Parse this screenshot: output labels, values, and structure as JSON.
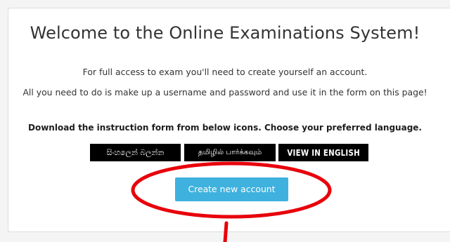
{
  "welcome": {
    "title": "Welcome to the Online Examinations System!",
    "access_text": "For full access to exam you'll need to create yourself an account.",
    "instructions_text": "All you need to do is make up a username and password and use it in the form on this page!",
    "download_text": "Download the instruction form from below icons. Choose your preferred language."
  },
  "languages": {
    "sinhala_label": "සිංහලෙන් බලන්න",
    "tamil_label": "தமிழில் பார்க்கவும்",
    "english_label": "VIEW IN ENGLISH"
  },
  "actions": {
    "create_account_label": "Create new account"
  },
  "annotation": {
    "color": "#e8000b"
  },
  "colors": {
    "primary_button": "#3fb1de",
    "language_button_bg": "#000000"
  }
}
